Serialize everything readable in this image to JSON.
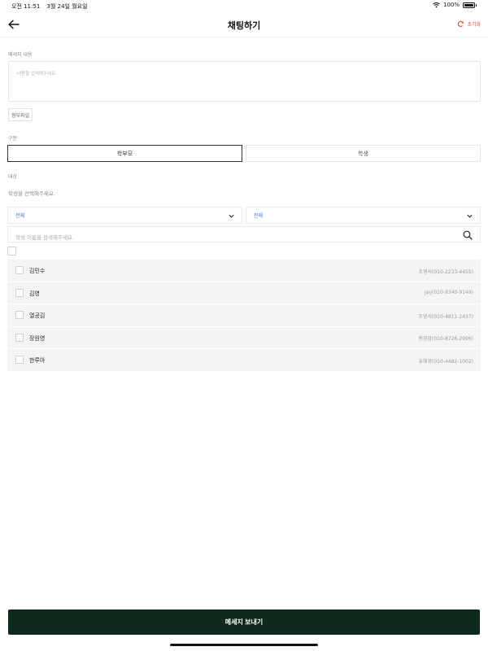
{
  "status_bar": {
    "time": "오전 11:51",
    "date": "3월 24일 월요일",
    "battery": "100%"
  },
  "header": {
    "title": "채팅하기",
    "reset_label": "초기화"
  },
  "message": {
    "label": "메세지 내용",
    "placeholder": "내용을 입력해주세요",
    "attach_label": "첨부파일"
  },
  "category": {
    "label": "구분",
    "options": [
      "학부모",
      "학생"
    ],
    "selected": "학부모"
  },
  "target": {
    "label": "대상",
    "hint": "학생을 선택해주세요.",
    "filter_1": "전체",
    "filter_2": "전체",
    "search_placeholder": "학생 이름을 검색해주세요."
  },
  "students": [
    {
      "name": "김민수",
      "parent": "조영서(010-2233-4455)"
    },
    {
      "name": "김영",
      "parent": "jay(010-9340-9149)"
    },
    {
      "name": "열공김",
      "parent": "조영서(010-4811-2437)"
    },
    {
      "name": "장원영",
      "parent": "원영맘(010-8726-2996)"
    },
    {
      "name": "한루아",
      "parent": "유혜경(010-4482-1002)"
    }
  ],
  "send_button": "메세지 보내기",
  "colors": {
    "accent_red": "#e04b3f",
    "primary_dark_green": "#0d2a1c",
    "link_blue": "#3a6fd8"
  }
}
